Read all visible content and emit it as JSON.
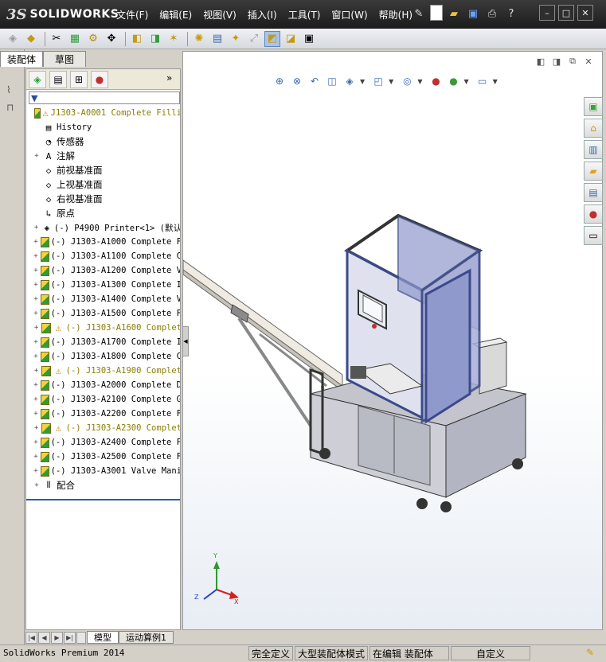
{
  "app": {
    "logo_ds": "3S",
    "logo_text": "SOLIDWORKS"
  },
  "menu": [
    "文件(F)",
    "编辑(E)",
    "视图(V)",
    "插入(I)",
    "工具(T)",
    "窗口(W)",
    "帮助(H)"
  ],
  "panel_tabs": [
    "装配体",
    "草图"
  ],
  "feature_tree": {
    "root": "J1303-A0001 Complete Filli",
    "items": [
      {
        "label": "History",
        "icon": "history-icon",
        "expand": false
      },
      {
        "label": "传感器",
        "icon": "sensor-icon",
        "expand": false
      },
      {
        "label": "注解",
        "icon": "annotation-icon",
        "expand": true
      },
      {
        "label": "前视基准面",
        "icon": "plane-icon",
        "expand": false
      },
      {
        "label": "上视基准面",
        "icon": "plane-icon",
        "expand": false
      },
      {
        "label": "右视基准面",
        "icon": "plane-icon",
        "expand": false
      },
      {
        "label": "原点",
        "icon": "origin-icon",
        "expand": false
      },
      {
        "label": "(-) P4900 Printer<1> (默认",
        "icon": "part-icon",
        "expand": true
      },
      {
        "label": "(-) J1303-A1000 Complete F",
        "icon": "assembly-icon",
        "expand": true
      },
      {
        "label": "(-) J1303-A1100 Complete C",
        "icon": "assembly-icon",
        "expand": true
      },
      {
        "label": "(-) J1303-A1200 Complete V",
        "icon": "assembly-icon",
        "expand": true
      },
      {
        "label": "(-) J1303-A1300 Complete I",
        "icon": "assembly-icon",
        "expand": true
      },
      {
        "label": "(-) J1303-A1400 Complete V",
        "icon": "assembly-icon",
        "expand": true
      },
      {
        "label": "(-) J1303-A1500 Complete F",
        "icon": "assembly-icon",
        "expand": true
      },
      {
        "label": "(-) J1303-A1600 Complet",
        "icon": "assembly-icon",
        "warn": true,
        "expand": true
      },
      {
        "label": "(-) J1303-A1700 Complete I",
        "icon": "assembly-icon",
        "expand": true
      },
      {
        "label": "(-) J1303-A1800 Complete C",
        "icon": "assembly-icon",
        "expand": true
      },
      {
        "label": "(-) J1303-A1900 Complet",
        "icon": "assembly-icon",
        "warn": true,
        "expand": true
      },
      {
        "label": "(-) J1303-A2000 Complete D",
        "icon": "assembly-icon",
        "expand": true
      },
      {
        "label": "(-) J1303-A2100 Complete G",
        "icon": "assembly-icon",
        "expand": true
      },
      {
        "label": "(-) J1303-A2200 Complete F",
        "icon": "assembly-icon",
        "expand": true
      },
      {
        "label": "(-) J1303-A2300 Complet",
        "icon": "assembly-icon",
        "warn": true,
        "expand": true
      },
      {
        "label": "(-) J1303-A2400 Complete F",
        "icon": "assembly-icon",
        "expand": true
      },
      {
        "label": "(-) J1303-A2500 Complete F",
        "icon": "assembly-icon",
        "expand": true
      },
      {
        "label": "(-) J1303-A3001 Valve Mani",
        "icon": "assembly-icon",
        "expand": true
      },
      {
        "label": "配合",
        "icon": "mates-icon",
        "expand": true
      }
    ]
  },
  "model_tabs": [
    "模型",
    "运动算例1"
  ],
  "status": {
    "app": "SolidWorks Premium 2014",
    "segments": [
      "完全定义",
      "大型装配体模式",
      "在编辑 装配体",
      "自定义"
    ]
  },
  "triad": {
    "x": "X",
    "y": "Y",
    "z": "Z"
  },
  "colors": {
    "titlebar": "#2a2a2a",
    "warning": "#8b7d00",
    "frame": "#3b4a8a",
    "machine": "#a9abb5"
  }
}
